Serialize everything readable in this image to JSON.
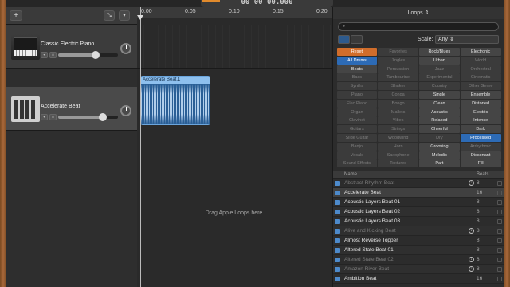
{
  "lcd": {
    "display": "00 00 00.000"
  },
  "tracks_header": {
    "add_button": "+",
    "smart_button": "⤡",
    "filter_button": "▾"
  },
  "tracks": [
    {
      "name": "Classic Electric Piano",
      "volume": 0.62
    },
    {
      "name": "Accelerate Beat",
      "volume": 0.75
    }
  ],
  "ruler": {
    "marks": [
      "0:00",
      "0:05",
      "0:10",
      "0:15",
      "0:20"
    ]
  },
  "region": {
    "title": "Accelerate Beat.1"
  },
  "timeline": {
    "drag_hint": "Drag Apple Loops here."
  },
  "loops": {
    "title": "Loops",
    "search_placeholder": "",
    "scale_label": "Scale:",
    "scale_value": "Any",
    "grid": [
      [
        "Reset",
        "Favorites",
        "Rock/Blues",
        "Electronic"
      ],
      [
        "All Drums",
        "Jingles",
        "Urban",
        "World"
      ],
      [
        "Beats",
        "Percussion",
        "Jazz",
        "Orchestral"
      ],
      [
        "Bass",
        "Tambourine",
        "Experimental",
        "Cinematic"
      ],
      [
        "Synths",
        "Shaker",
        "Country",
        "Other Genre"
      ],
      [
        "Piano",
        "Conga",
        "Single",
        "Ensemble"
      ],
      [
        "Elec Piano",
        "Bongo",
        "Clean",
        "Distorted"
      ],
      [
        "Organ",
        "Mallets",
        "Acoustic",
        "Electric"
      ],
      [
        "Clavinet",
        "Vibes",
        "Relaxed",
        "Intense"
      ],
      [
        "Guitars",
        "Strings",
        "Cheerful",
        "Dark"
      ],
      [
        "Slide Guitar",
        "Woodwind",
        "Dry",
        "Processed"
      ],
      [
        "Banjo",
        "Horn",
        "Grooving",
        "Arrhythmic"
      ],
      [
        "Vocals",
        "Saxophone",
        "Melodic",
        "Dissonant"
      ],
      [
        "Sound Effects",
        "Textures",
        "Part",
        "Fill"
      ]
    ],
    "list_header": {
      "name": "Name",
      "beats": "Beats"
    },
    "list": [
      {
        "name": "Abstract Rhythm Beat",
        "beats": "8",
        "available": false,
        "download": true
      },
      {
        "name": "Accelerate Beat",
        "beats": "16",
        "available": true,
        "download": false,
        "selected": true
      },
      {
        "name": "Acoustic Layers Beat 01",
        "beats": "8",
        "available": true,
        "download": false
      },
      {
        "name": "Acoustic Layers Beat 02",
        "beats": "8",
        "available": true,
        "download": false
      },
      {
        "name": "Acoustic Layers Beat 03",
        "beats": "8",
        "available": true,
        "download": false
      },
      {
        "name": "Alive and Kicking Beat",
        "beats": "8",
        "available": false,
        "download": true
      },
      {
        "name": "Almost Reverse Topper",
        "beats": "8",
        "available": true,
        "download": false
      },
      {
        "name": "Altered State Beat 01",
        "beats": "8",
        "available": true,
        "download": false
      },
      {
        "name": "Altered State Beat 02",
        "beats": "8",
        "available": false,
        "download": true
      },
      {
        "name": "Amazon River Beat",
        "beats": "8",
        "available": false,
        "download": true
      },
      {
        "name": "Ambition Beat",
        "beats": "16",
        "available": true,
        "download": false
      }
    ]
  }
}
